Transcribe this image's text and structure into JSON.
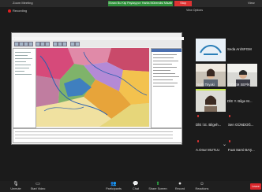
{
  "app": {
    "title": "Zoom Meeting",
    "recording": "Recording"
  },
  "banner": {
    "share_text": "Ekranı Bu Kişi Paylaşıyor: Harita Mühendisi Misafir",
    "stop_share": "Stop",
    "more_options": "View Options",
    "view": "View"
  },
  "participants": [
    {
      "name": "Seda Arı/SFGM"
    },
    {
      "name": "Nazlı Tiryaki"
    },
    {
      "name": "ÖZLEM SEPİK"
    },
    {
      "name": "DİE Y. Bilge M..."
    },
    {
      "name": "DİE İ.E. Bilgeh..."
    },
    {
      "name": "Sen GÜNDOĞ..."
    },
    {
      "name": "A.Onur MUTLU"
    },
    {
      "name": "Fuat Sami BAŞ..."
    }
  ],
  "bottom": {
    "unmute": "Unmute",
    "start_video": "Start Video",
    "participants": "Participants",
    "participants_count": "31",
    "chat": "Chat",
    "share_screen": "Share Screen",
    "record": "Record",
    "reactions": "Reactions",
    "leave": "Leave"
  },
  "colors": {
    "share_green": "#2f8f3a",
    "leave_red": "#d9262b",
    "record_red": "#e02020"
  }
}
